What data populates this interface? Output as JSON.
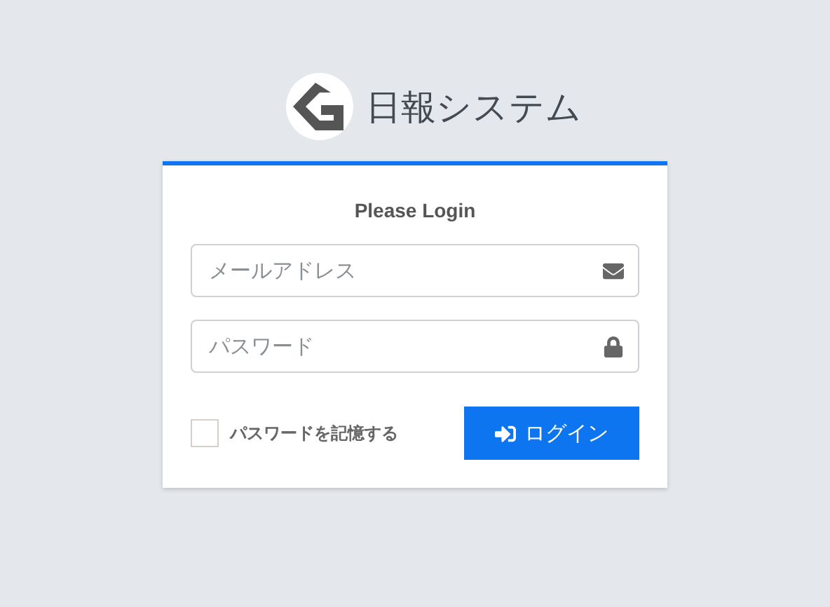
{
  "brand": {
    "title": "日報システム"
  },
  "login": {
    "heading": "Please Login",
    "fields": [
      {
        "kind": "email",
        "placeholder": "メールアドレス"
      },
      {
        "kind": "password",
        "placeholder": "パスワード"
      }
    ],
    "remember": {
      "label": "パスワードを記憶する",
      "checked": false
    },
    "submit": {
      "label": "ログイン"
    }
  }
}
